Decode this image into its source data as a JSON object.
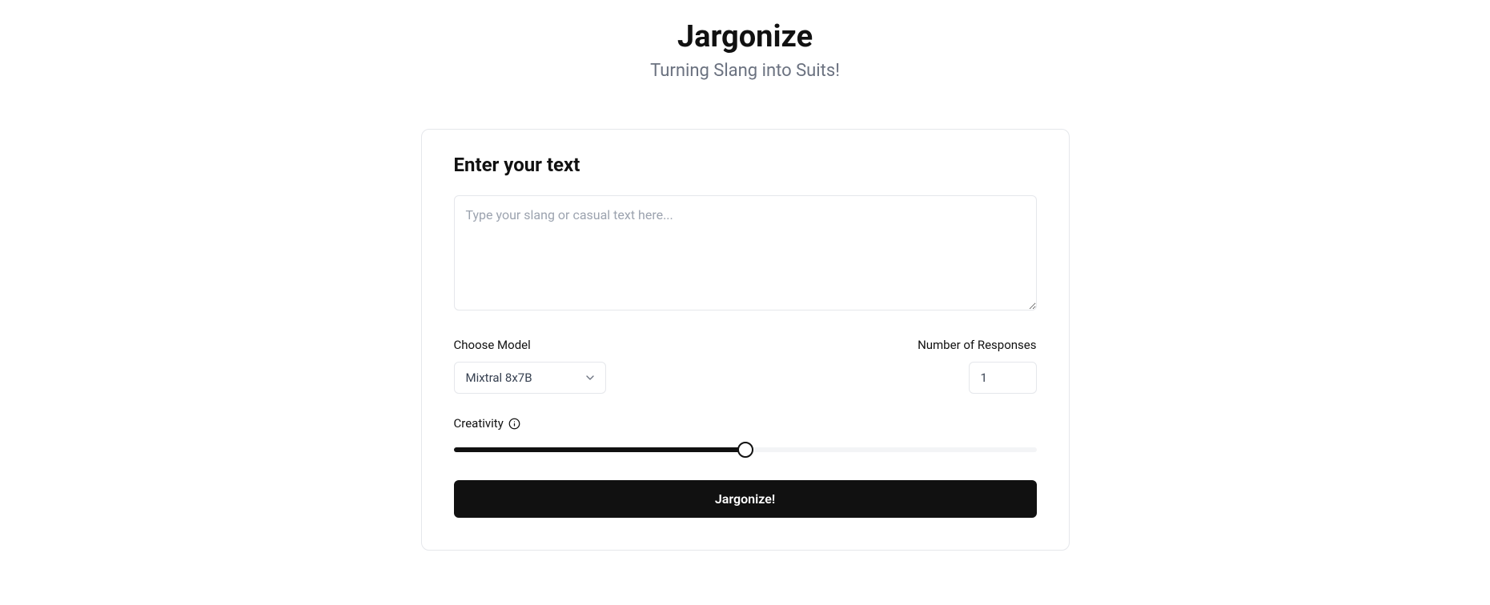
{
  "header": {
    "title": "Jargonize",
    "subtitle": "Turning Slang into Suits!"
  },
  "form": {
    "section_title": "Enter your text",
    "textarea_placeholder": "Type your slang or casual text here...",
    "textarea_value": "",
    "model": {
      "label": "Choose Model",
      "selected": "Mixtral 8x7B"
    },
    "responses": {
      "label": "Number of Responses",
      "value": "1"
    },
    "creativity": {
      "label": "Creativity",
      "percent": 50
    },
    "submit_label": "Jargonize!"
  }
}
